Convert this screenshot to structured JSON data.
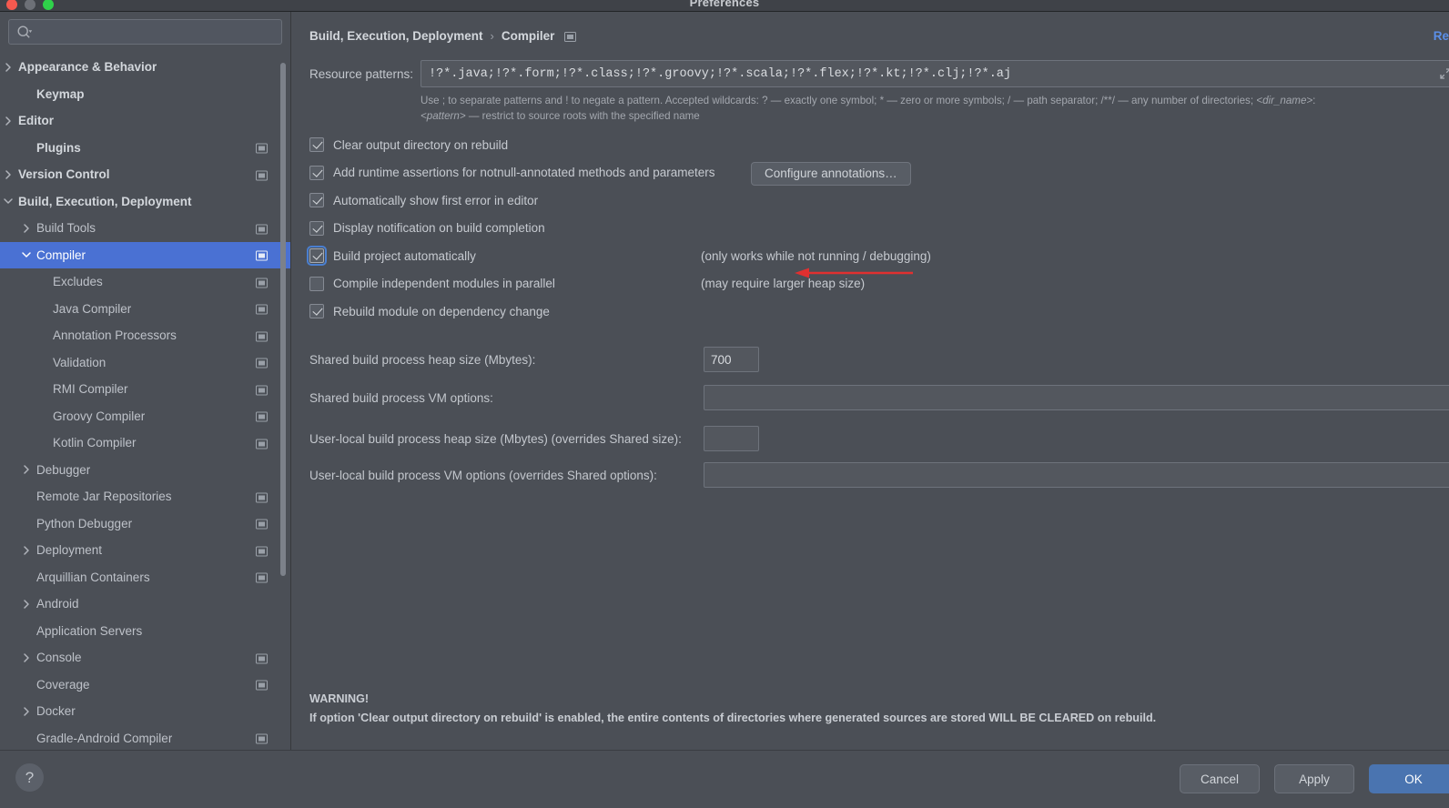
{
  "window": {
    "title": "Preferences",
    "traffic_lights": [
      "close-button",
      "minimize-button",
      "zoom-button"
    ]
  },
  "sidebar": {
    "search": {
      "value": "",
      "placeholder": ""
    },
    "items": [
      {
        "label": "Appearance & Behavior",
        "indent": 0,
        "twisty": "right",
        "bold": true,
        "monitor": false,
        "selected": false
      },
      {
        "label": "Keymap",
        "indent": 1,
        "twisty": "none",
        "bold": true,
        "monitor": false,
        "selected": false
      },
      {
        "label": "Editor",
        "indent": 0,
        "twisty": "right",
        "bold": true,
        "monitor": false,
        "selected": false
      },
      {
        "label": "Plugins",
        "indent": 1,
        "twisty": "none",
        "bold": true,
        "monitor": true,
        "selected": false
      },
      {
        "label": "Version Control",
        "indent": 0,
        "twisty": "right",
        "bold": true,
        "monitor": true,
        "selected": false
      },
      {
        "label": "Build, Execution, Deployment",
        "indent": 0,
        "twisty": "down",
        "bold": true,
        "monitor": false,
        "selected": false
      },
      {
        "label": "Build Tools",
        "indent": 1,
        "twisty": "right",
        "bold": false,
        "monitor": true,
        "selected": false
      },
      {
        "label": "Compiler",
        "indent": 1,
        "twisty": "down",
        "bold": false,
        "monitor": true,
        "selected": true
      },
      {
        "label": "Excludes",
        "indent": 2,
        "twisty": "none",
        "bold": false,
        "monitor": true,
        "selected": false
      },
      {
        "label": "Java Compiler",
        "indent": 2,
        "twisty": "none",
        "bold": false,
        "monitor": true,
        "selected": false
      },
      {
        "label": "Annotation Processors",
        "indent": 2,
        "twisty": "none",
        "bold": false,
        "monitor": true,
        "selected": false
      },
      {
        "label": "Validation",
        "indent": 2,
        "twisty": "none",
        "bold": false,
        "monitor": true,
        "selected": false
      },
      {
        "label": "RMI Compiler",
        "indent": 2,
        "twisty": "none",
        "bold": false,
        "monitor": true,
        "selected": false
      },
      {
        "label": "Groovy Compiler",
        "indent": 2,
        "twisty": "none",
        "bold": false,
        "monitor": true,
        "selected": false
      },
      {
        "label": "Kotlin Compiler",
        "indent": 2,
        "twisty": "none",
        "bold": false,
        "monitor": true,
        "selected": false
      },
      {
        "label": "Debugger",
        "indent": 1,
        "twisty": "right",
        "bold": false,
        "monitor": false,
        "selected": false
      },
      {
        "label": "Remote Jar Repositories",
        "indent": 1,
        "twisty": "none",
        "bold": false,
        "monitor": true,
        "selected": false
      },
      {
        "label": "Python Debugger",
        "indent": 1,
        "twisty": "none",
        "bold": false,
        "monitor": true,
        "selected": false
      },
      {
        "label": "Deployment",
        "indent": 1,
        "twisty": "right",
        "bold": false,
        "monitor": true,
        "selected": false
      },
      {
        "label": "Arquillian Containers",
        "indent": 1,
        "twisty": "none",
        "bold": false,
        "monitor": true,
        "selected": false
      },
      {
        "label": "Android",
        "indent": 1,
        "twisty": "right",
        "bold": false,
        "monitor": false,
        "selected": false
      },
      {
        "label": "Application Servers",
        "indent": 1,
        "twisty": "none",
        "bold": false,
        "monitor": false,
        "selected": false
      },
      {
        "label": "Console",
        "indent": 1,
        "twisty": "right",
        "bold": false,
        "monitor": true,
        "selected": false
      },
      {
        "label": "Coverage",
        "indent": 1,
        "twisty": "none",
        "bold": false,
        "monitor": true,
        "selected": false
      },
      {
        "label": "Docker",
        "indent": 1,
        "twisty": "right",
        "bold": false,
        "monitor": false,
        "selected": false
      },
      {
        "label": "Gradle-Android Compiler",
        "indent": 1,
        "twisty": "none",
        "bold": false,
        "monitor": true,
        "selected": false
      }
    ]
  },
  "main": {
    "breadcrumb": {
      "root": "Build, Execution, Deployment",
      "separator": "›",
      "leaf": "Compiler"
    },
    "reset_link": "Re",
    "resource_patterns": {
      "label": "Resource patterns:",
      "value": "!?*.java;!?*.form;!?*.class;!?*.groovy;!?*.scala;!?*.flex;!?*.kt;!?*.clj;!?*.aj",
      "help_line1": "Use ; to separate patterns and ! to negate a pattern. Accepted wildcards: ? — exactly one symbol; * — zero or more symbols; / — path separator; /**/ — any number of directories; ",
      "help_dir_name": "<dir_name>",
      "help_line1_tail": ":",
      "help_pattern": "<pattern>",
      "help_line2_tail": " — restrict to source roots with the specified name"
    },
    "checkboxes": [
      {
        "label": "Clear output directory on rebuild",
        "checked": true,
        "focused": false,
        "note": "",
        "button": ""
      },
      {
        "label": "Add runtime assertions for notnull-annotated methods and parameters",
        "checked": true,
        "focused": false,
        "note": "",
        "button": "Configure annotations…"
      },
      {
        "label": "Automatically show first error in editor",
        "checked": true,
        "focused": false,
        "note": "",
        "button": ""
      },
      {
        "label": "Display notification on build completion",
        "checked": true,
        "focused": false,
        "note": "",
        "button": ""
      },
      {
        "label": "Build project automatically",
        "checked": true,
        "focused": true,
        "note": "(only works while not running / debugging)",
        "button": ""
      },
      {
        "label": "Compile independent modules in parallel",
        "checked": false,
        "focused": false,
        "note": "(may require larger heap size)",
        "button": ""
      },
      {
        "label": "Rebuild module on dependency change",
        "checked": true,
        "focused": false,
        "note": "",
        "button": ""
      }
    ],
    "fields": [
      {
        "label": "Shared build process heap size (Mbytes):",
        "value": "700",
        "wide": false
      },
      {
        "label": "Shared build process VM options:",
        "value": "",
        "wide": true
      },
      {
        "label": "User-local build process heap size (Mbytes) (overrides Shared size):",
        "value": "",
        "wide": false
      },
      {
        "label": "User-local build process VM options (overrides Shared options):",
        "value": "",
        "wide": true
      }
    ],
    "warning_title": "WARNING!",
    "warning_body": "If option 'Clear output directory on rebuild' is enabled, the entire contents of directories where generated sources are stored WILL BE CLEARED on rebuild."
  },
  "footer": {
    "help_glyph": "?",
    "buttons": [
      {
        "label": "Cancel",
        "primary": false
      },
      {
        "label": "Apply",
        "primary": false
      },
      {
        "label": "OK",
        "primary": true
      }
    ]
  },
  "annotation": {
    "arrow_color": "#e03030",
    "points_to": "build-project-automatically-checkbox"
  },
  "colors": {
    "window_bg": "#4b4f56",
    "titlebar_bg": "#3f4248",
    "selection_blue": "#4a71d3",
    "link_blue": "#5b8fe8",
    "primary_button": "#4a74b0",
    "text": "#c6cad0",
    "muted_text": "#a3a7ae"
  }
}
